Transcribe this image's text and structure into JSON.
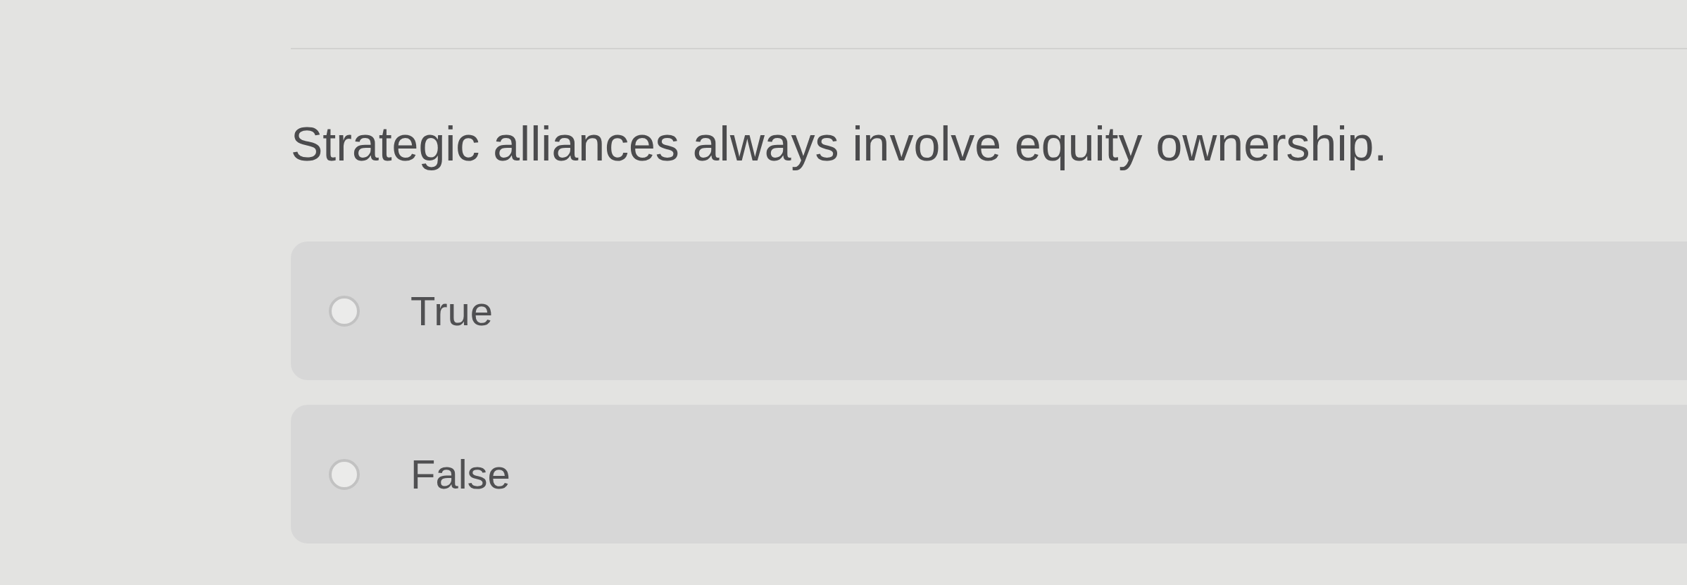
{
  "question": "Strategic alliances always involve equity ownership.",
  "options": [
    {
      "label": "True",
      "selected": false
    },
    {
      "label": "False",
      "selected": false
    }
  ]
}
